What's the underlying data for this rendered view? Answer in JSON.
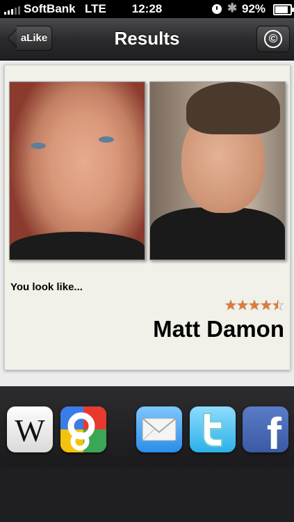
{
  "status_bar": {
    "carrier": "SoftBank",
    "network": "LTE",
    "time": "12:28",
    "battery": "92%"
  },
  "nav": {
    "back_label": "aLike",
    "title": "Results",
    "copyright_symbol": "©"
  },
  "result": {
    "prompt": "You look like...",
    "match_name": "Matt Damon",
    "rating": 4.5,
    "rating_max": 5
  },
  "share_icons": [
    {
      "name": "wikipedia-icon",
      "glyph": "W"
    },
    {
      "name": "google-icon",
      "glyph": "g"
    },
    {
      "name": "mail-icon",
      "glyph": "✉"
    },
    {
      "name": "twitter-icon",
      "glyph": "t"
    },
    {
      "name": "facebook-icon",
      "glyph": "f"
    }
  ],
  "colors": {
    "nav_bg": "#2b2b2d",
    "card_bg": "#f1f0e9",
    "star_fill": "#e07a3a"
  }
}
